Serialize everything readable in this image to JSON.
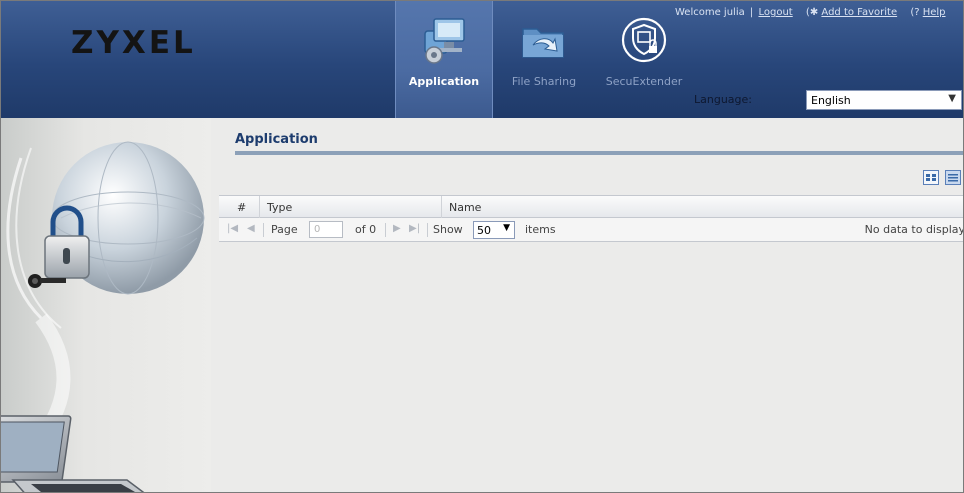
{
  "brand": {
    "logo_text": "ZYXEL"
  },
  "nav": {
    "tabs": [
      {
        "label": "Application",
        "active": true,
        "icon": "application-icon"
      },
      {
        "label": "File Sharing",
        "active": false,
        "icon": "file-sharing-icon"
      },
      {
        "label": "SecuExtender",
        "active": false,
        "icon": "secuextender-shield-icon"
      }
    ]
  },
  "top_links": {
    "welcome": "Welcome julia",
    "separator": "|",
    "logout": "Logout",
    "add_favorite_icon": "(",
    "add_favorite_glyph": "✱",
    "add_favorite": "Add to Favorite",
    "help_glyph": "(?",
    "help": "Help"
  },
  "language": {
    "label": "Language:",
    "selected": "English"
  },
  "main": {
    "section_title": "Application",
    "grid": {
      "columns": [
        "#",
        "Type",
        "Name"
      ],
      "rows": []
    },
    "pager": {
      "page_label": "Page",
      "page_value": "0",
      "of_label": "of 0",
      "show_label": "Show",
      "page_size": "50",
      "items_label": "items",
      "empty_message": "No data to display"
    }
  },
  "colors": {
    "header_bg": "#28467a",
    "active_tab_bg": "#4b6ba2",
    "title_color": "#1d3c6e",
    "rule_color": "#8ca0b8"
  }
}
